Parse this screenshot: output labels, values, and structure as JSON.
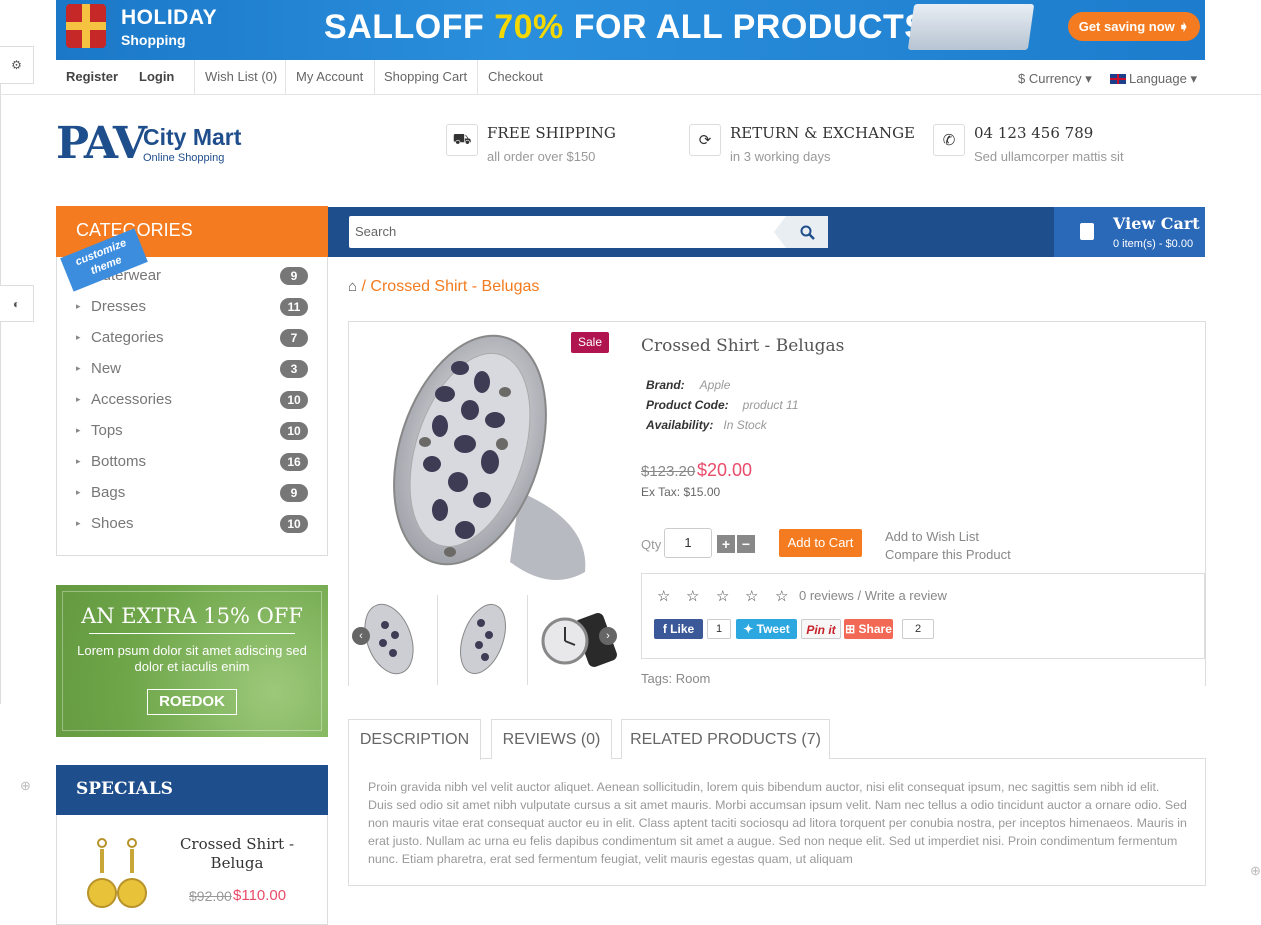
{
  "banner": {
    "title": "HOLIDAY",
    "subtitle": "Shopping",
    "sale_text": "SALLOFF",
    "sale_pct": "70%",
    "sale_rest": "FOR ALL PRODUCTS",
    "cta": "Get saving now ➧"
  },
  "topbar": {
    "register": "Register",
    "login": "Login",
    "wishlist": "Wish List (0)",
    "account": "My Account",
    "cart": "Shopping Cart",
    "checkout": "Checkout",
    "currency": "$ Currency ▾",
    "language": "Language ▾"
  },
  "logo": {
    "main": "PAV",
    "city": "City Mart",
    "sub": "Online Shopping"
  },
  "features": [
    {
      "icon": "truck-icon",
      "title": "FREE SHIPPING",
      "sub": "all order over $150"
    },
    {
      "icon": "refresh-icon",
      "title": "RETURN & EXCHANGE",
      "sub": "in 3 working days"
    },
    {
      "icon": "phone-icon",
      "title": "04 123 456 789",
      "sub": "Sed ullamcorper mattis sit"
    }
  ],
  "categories": {
    "title": "CATEGORIES",
    "customize": "customize theme",
    "items": [
      {
        "label": "Outerwear",
        "count": "9"
      },
      {
        "label": "Dresses",
        "count": "11"
      },
      {
        "label": "Categories",
        "count": "7"
      },
      {
        "label": "New",
        "count": "3"
      },
      {
        "label": "Accessories",
        "count": "10"
      },
      {
        "label": "Tops",
        "count": "10"
      },
      {
        "label": "Bottoms",
        "count": "16"
      },
      {
        "label": "Bags",
        "count": "9"
      },
      {
        "label": "Shoes",
        "count": "10"
      }
    ]
  },
  "promo": {
    "title": "AN EXTRA 15% OFF",
    "text": "Lorem psum dolor sit amet adiscing sed dolor et iaculis enim",
    "button": "ROEDOK"
  },
  "specials": {
    "title": "SPECIALS",
    "product_name": "Crossed Shirt - Beluga",
    "old_price": "$92.00",
    "price": "$110.00"
  },
  "search": {
    "placeholder": "Search"
  },
  "cart": {
    "title": "View Cart",
    "summary": "0 item(s) - $0.00"
  },
  "breadcrumb": {
    "current": "Crossed Shirt - Belugas"
  },
  "product": {
    "badge": "Sale",
    "title": "Crossed Shirt - Belugas",
    "brand_label": "Brand:",
    "brand": "Apple",
    "code_label": "Product Code:",
    "code": "product 11",
    "avail_label": "Availability:",
    "avail": "In Stock",
    "old_price": "$123.20",
    "price": "$20.00",
    "ex_tax": "Ex Tax: $15.00",
    "qty_label": "Qty",
    "qty": "1",
    "add_to_cart": "Add to Cart",
    "wishlist": "Add to Wish List",
    "compare": "Compare this Product",
    "reviews": "0 reviews / Write a review",
    "rating": 0,
    "like": "Like",
    "like_count": "1",
    "tweet": "Tweet",
    "pin": "Pin it",
    "share": "Share",
    "share_count": "2",
    "tags_label": "Tags:",
    "tags": "Room"
  },
  "tabs": [
    {
      "label": "DESCRIPTION"
    },
    {
      "label": "REVIEWS (0)"
    },
    {
      "label": "RELATED PRODUCTS (7)"
    }
  ],
  "description": "Proin gravida nibh vel velit auctor aliquet. Aenean sollicitudin, lorem quis bibendum auctor, nisi elit consequat ipsum, nec sagittis sem nibh id elit. Duis sed odio sit amet nibh vulputate cursus a sit amet mauris. Morbi accumsan ipsum velit. Nam nec tellus a odio tincidunt auctor a ornare odio. Sed non mauris vitae erat consequat auctor eu in elit. Class aptent taciti sociosqu ad litora torquent per conubia nostra, per inceptos himenaeos. Mauris in erat justo. Nullam ac urna eu felis dapibus condimentum sit amet a augue. Sed non neque elit. Sed ut imperdiet nisi. Proin condimentum fermentum nunc. Etiam pharetra, erat sed fermentum feugiat, velit mauris egestas quam, ut aliquam",
  "colors": {
    "accent": "#f47b20",
    "brand": "#1f4e8c",
    "price": "#e94b6a",
    "sale": "#b0154f"
  }
}
